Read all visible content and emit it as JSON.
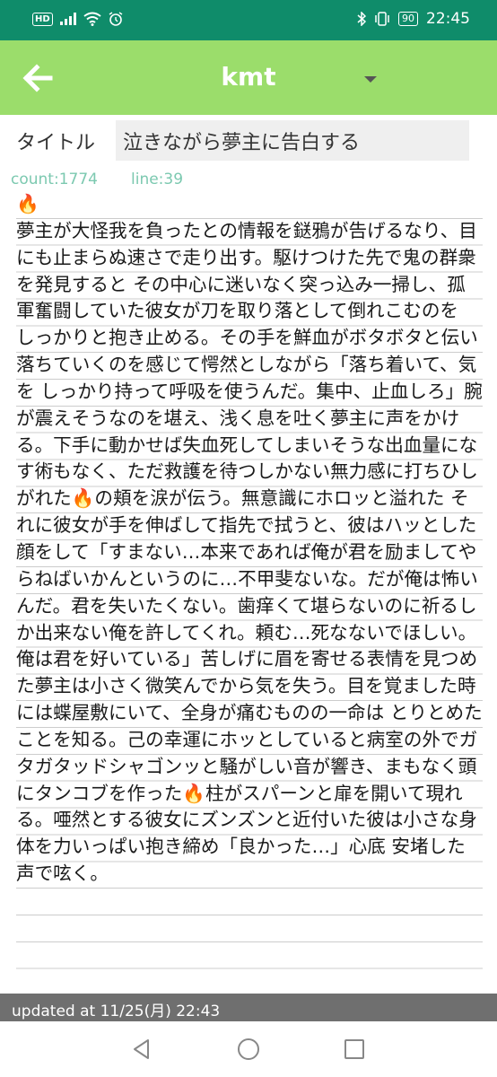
{
  "status_bar": {
    "hd_label": "HD",
    "battery": "90",
    "time": "22:45",
    "icons": [
      "signal-icon",
      "wifi-icon",
      "alarm-icon",
      "bluetooth-icon",
      "vibrate-icon",
      "battery-icon"
    ]
  },
  "toolbar": {
    "title": "kmt",
    "back_icon": "arrow-left-icon",
    "dropdown_icon": "caret-down-icon"
  },
  "editor": {
    "title_label": "タイトル",
    "title_value": "泣きながら夢主に告白する",
    "count_label": "count:1774",
    "line_label": "line:39",
    "body": "🔥\n夢主が大怪我を負ったとの情報を鎹鴉が告げるなり、目にも止まらぬ速さで走り出す。駆けつけた先で鬼の群衆を発見すると その中心に迷いなく突っ込み一掃し、孤軍奮闘していた彼女が刀を取り落として倒れこむのを しっかりと抱き止める。その手を鮮血がボタボタと伝い落ちていくのを感じて愕然としながら「落ち着いて、気を しっかり持って呼吸を使うんだ。集中、止血しろ」腕が震えそうなのを堪え、浅く息を吐く夢主に声をかける。下手に動かせば失血死してしまいそうな出血量になす術もなく、ただ救護を待つしかない無力感に打ちひしがれた🔥の頬を涙が伝う。無意識にホロッと溢れた それに彼女が手を伸ばして指先で拭うと、彼はハッとした顔をして「すまない…本来であれば俺が君を励ましてやらねばいかんというのに…不甲斐ないな。だが俺は怖いんだ。君を失いたくない。歯痒くて堪らないのに祈るしか出来ない俺を許してくれ。頼む…死なないでほしい。俺は君を好いている」苦しげに眉を寄せる表情を見つめた夢主は小さく微笑んでから気を失う。目を覚ました時には蝶屋敷にいて、全身が痛むものの一命は とりとめたことを知る。己の幸運にホッとしていると病室の外でガタガタッドシャゴンッと騒がしい音が響き、まもなく頭にタンコブを作った🔥柱がスパーンと扉を開いて現れる。唖然とする彼女にズンズンと近付いた彼は小さな身体を力いっぱい抱き締め「良かった…」心底 安堵した声で呟く。"
  },
  "footer": {
    "updated": "updated at 11/25(月) 22:43"
  },
  "nav_bar": {
    "icons": [
      "nav-back-icon",
      "nav-home-icon",
      "nav-recent-icon"
    ]
  },
  "colors": {
    "status_bar": "#0f8c6a",
    "toolbar": "#9bdd6b",
    "meta_text": "#7cc9b0",
    "updated_bar": "#6f6f6f"
  }
}
